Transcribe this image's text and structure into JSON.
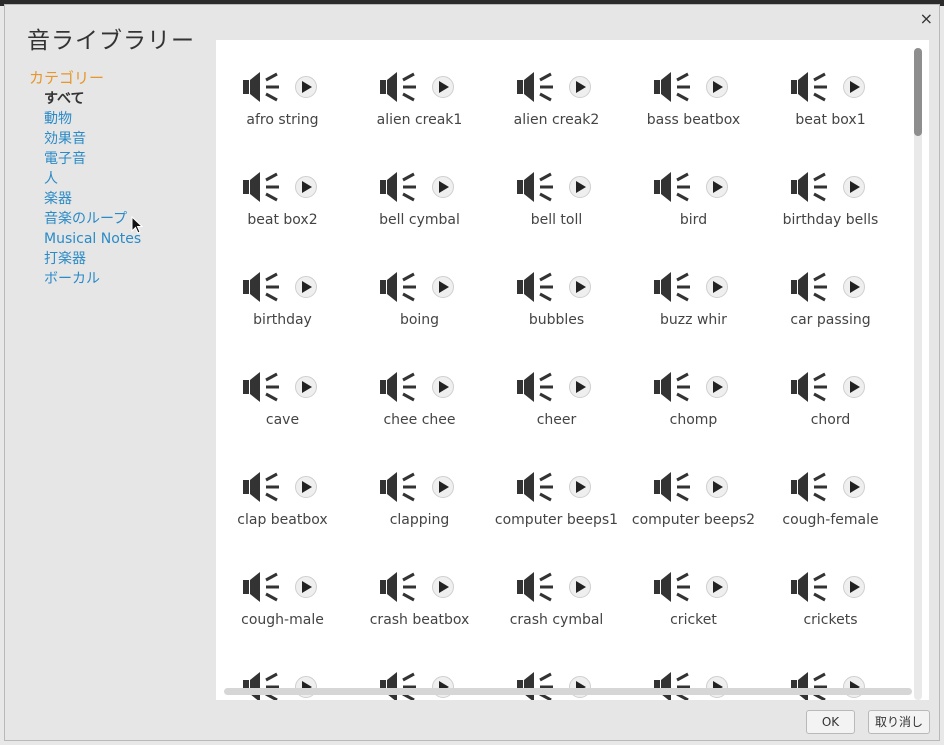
{
  "dialog": {
    "title": "音ライブラリー",
    "close_glyph": "×"
  },
  "sidebar": {
    "header": "カテゴリー",
    "selected_index": 0,
    "items": [
      "すべて",
      "動物",
      "効果音",
      "電子音",
      "人",
      "楽器",
      "音楽のループ",
      "Musical Notes",
      "打楽器",
      "ボーカル"
    ]
  },
  "sounds": [
    "afro string",
    "alien creak1",
    "alien creak2",
    "bass beatbox",
    "beat box1",
    "beat box2",
    "bell cymbal",
    "bell toll",
    "bird",
    "birthday bells",
    "birthday",
    "boing",
    "bubbles",
    "buzz whir",
    "car passing",
    "cave",
    "chee chee",
    "cheer",
    "chomp",
    "chord",
    "clap beatbox",
    "clapping",
    "computer beeps1",
    "computer beeps2",
    "cough-female",
    "cough-male",
    "crash beatbox",
    "crash cymbal",
    "cricket",
    "crickets",
    "",
    "",
    "",
    "",
    ""
  ],
  "footer": {
    "ok_label": "OK",
    "cancel_label": "取り消し"
  },
  "colors": {
    "accent_header": "#e6962a",
    "link": "#2a8bc7"
  }
}
